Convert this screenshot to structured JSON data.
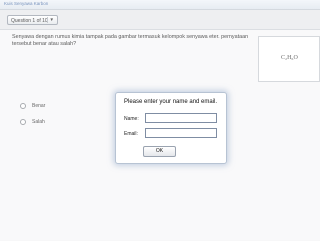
{
  "window": {
    "title": "Kuis Senyawa Karbon"
  },
  "question_selector": {
    "label": "Question 1 of 10",
    "chevron_icon": "chevron-down-icon"
  },
  "question": {
    "text": "Senyawa dengan rumus kimia tampak pada gambar termasuk kelompok senyawa eter. pernyataan tersebut benar atau salah?",
    "formula": "C₂H₆O"
  },
  "options": [
    {
      "label": "Benar"
    },
    {
      "label": "Salah"
    }
  ],
  "dialog": {
    "title": "Please enter your name and email.",
    "name_label": "Name:",
    "email_label": "Email:",
    "name_value": "",
    "email_value": "",
    "ok_label": "OK"
  }
}
